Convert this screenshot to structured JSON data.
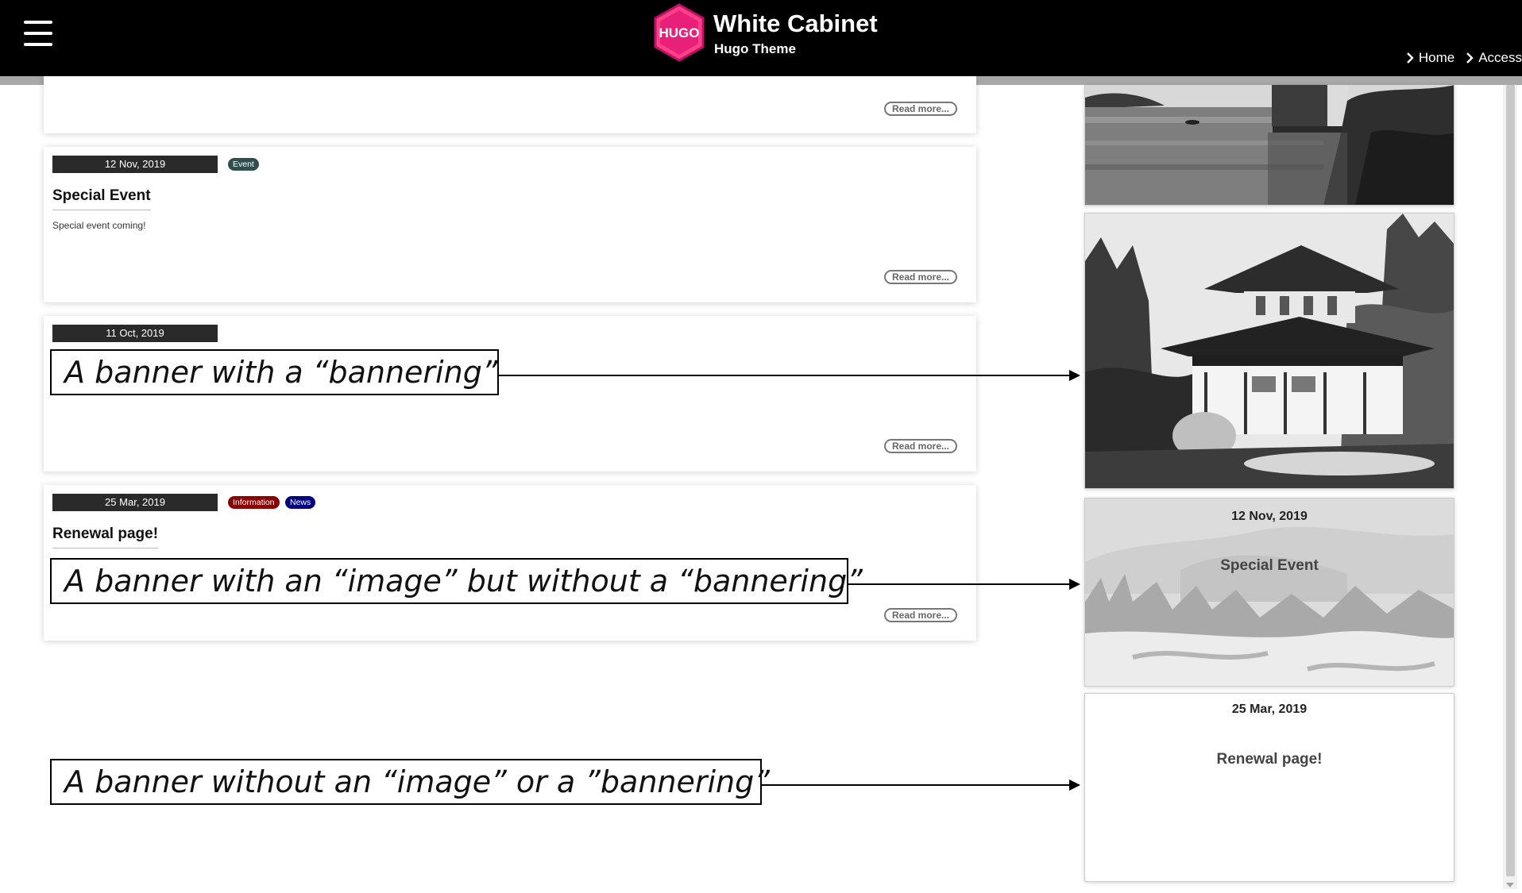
{
  "header": {
    "logo_text": "HUGO",
    "title": "White Cabinet",
    "subtitle": "Hugo Theme",
    "nav": [
      "Home",
      "Access"
    ]
  },
  "posts": [
    {
      "read_more": "Read more..."
    },
    {
      "date": "12 Nov, 2019",
      "tags": [
        {
          "label": "Event",
          "color": "#2f4f4f"
        }
      ],
      "title": "Special Event",
      "excerpt": "Special event coming!",
      "read_more": "Read more..."
    },
    {
      "date": "11 Oct, 2019",
      "read_more": "Read more..."
    },
    {
      "date": "25 Mar, 2019",
      "tags": [
        {
          "label": "Information",
          "color": "#8b0000"
        },
        {
          "label": "News",
          "color": "#000080"
        }
      ],
      "title": "Renewal page!",
      "read_more": "Read more..."
    }
  ],
  "annotations": [
    "A banner with a “bannering”",
    "A banner with an “image” but without a “bannering”",
    "A banner without an “image” or a ”bannering”"
  ],
  "sidebar": {
    "banners": [
      {
        "kind": "lake-photo"
      },
      {
        "kind": "temple-photo"
      },
      {
        "kind": "snow-photo",
        "date": "12 Nov, 2019",
        "title": "Special Event"
      },
      {
        "kind": "plain",
        "date": "25 Mar, 2019",
        "title": "Renewal page!"
      }
    ]
  },
  "colors": {
    "header_bg": "#000000",
    "header_rule": "#a8a8a8",
    "logo_accent": "#ff4088",
    "date_bg": "#2a2a2a"
  }
}
